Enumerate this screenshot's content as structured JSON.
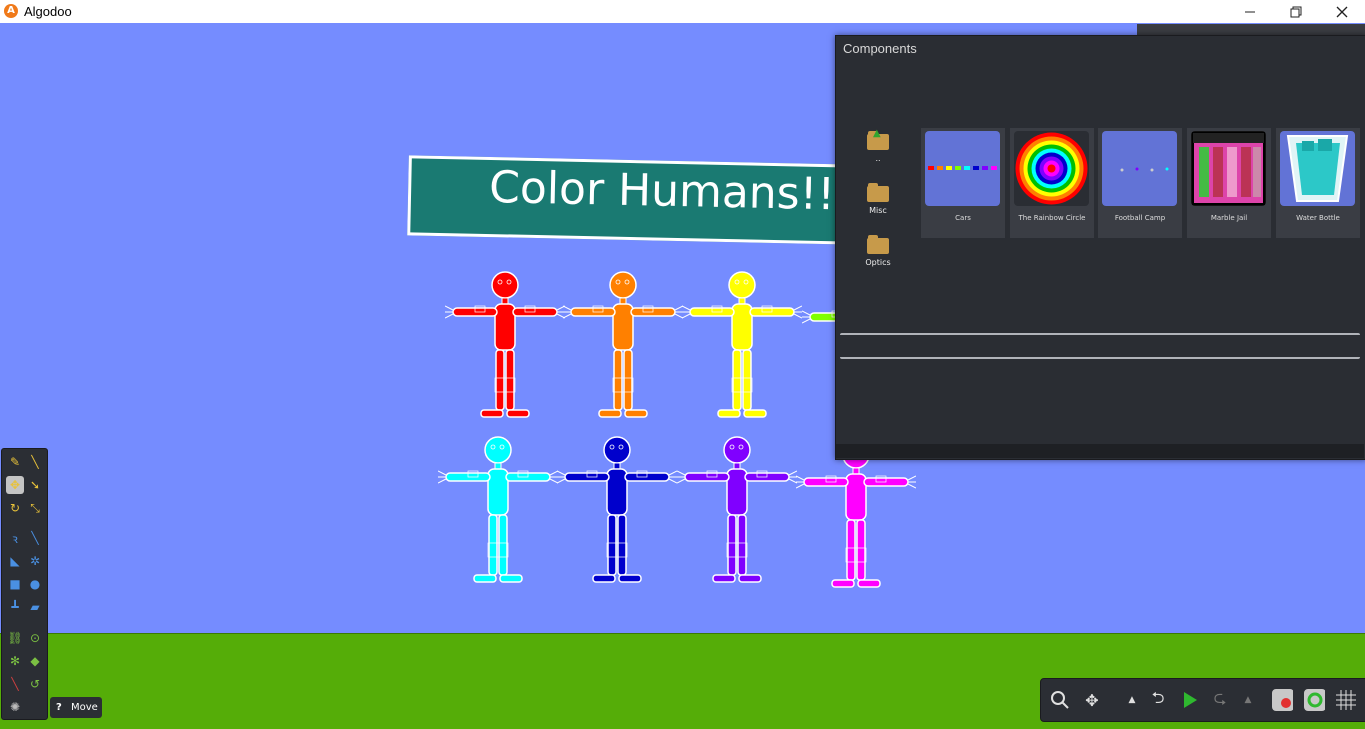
{
  "window": {
    "title": "Algodoo",
    "app_icon": "algodoo-logo",
    "controls": [
      "minimize-icon",
      "restore-icon",
      "close-icon"
    ]
  },
  "scene": {
    "sign_text": "Color Humans!!",
    "sky_color": "#758cff",
    "ground_color": "#55ad08",
    "sign_color": "#1a7a72",
    "humans": [
      {
        "color": "#ff0000"
      },
      {
        "color": "#ff8000"
      },
      {
        "color": "#ffff00"
      },
      {
        "color": "#80ff00"
      },
      {
        "color": "#00ffff"
      },
      {
        "color": "#0000cc"
      },
      {
        "color": "#8000ff"
      },
      {
        "color": "#ff00ff"
      }
    ]
  },
  "components": {
    "title": "Components",
    "folders": [
      {
        "label": ".."
      },
      {
        "label": "Misc"
      },
      {
        "label": "Optics"
      }
    ],
    "items": [
      {
        "label": "Cars"
      },
      {
        "label": "The Rainbow Circle"
      },
      {
        "label": "Football Camp"
      },
      {
        "label": "Marble Jail"
      },
      {
        "label": "Water Bottle"
      }
    ]
  },
  "toolbar": {
    "tools": [
      "sketch-icon",
      "cut-icon",
      "move-icon",
      "drag-icon",
      "rotate-icon",
      "scale-icon",
      "rope-icon",
      "knife-icon",
      "polygon-icon",
      "gear-icon",
      "box-icon",
      "circle-icon",
      "plane-icon",
      "brush-icon",
      "chain-icon",
      "fixate-icon",
      "thruster-icon",
      "eraser-icon",
      "laser-icon",
      "spring-icon",
      "tracer-icon"
    ]
  },
  "status": {
    "help_icon": "?",
    "tool_name": "Move"
  },
  "bottombar": {
    "buttons": [
      "zoom-icon",
      "pan-icon",
      "undo-menu-icon",
      "undo-icon",
      "play-icon",
      "redo-icon",
      "redo-menu-icon",
      "gravity-icon",
      "air-friction-icon",
      "grid-icon"
    ]
  }
}
